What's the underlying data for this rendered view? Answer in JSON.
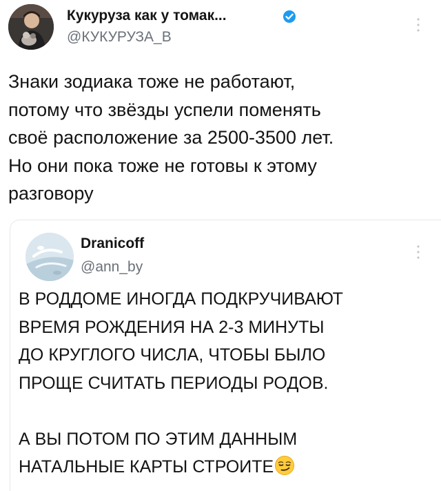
{
  "main_tweet": {
    "author_name": "Кукуруза как у томак...",
    "handle": "@КУКУРУЗА_В",
    "text": "Знаки зодиака тоже не работают,\nпотому что звёзды успели поменять\nсвоё расположение за 2500-3500 лет.\nНо они пока тоже не готовы к этому\nразговору",
    "verified_color": "#1d9bf0"
  },
  "quoted_tweet": {
    "author_name": "Dranicoff",
    "handle": "@ann_by",
    "text": "В РОДДОМЕ ИНОГДА ПОДКРУЧИВАЮТ\nВРЕМЯ РОЖДЕНИЯ НА 2-3 МИНУТЫ\nДО КРУГЛОГО ЧИСЛА, ЧТОБЫ БЫЛО\nПРОЩЕ СЧИТАТЬ ПЕРИОДЫ РОДОВ.\n\nА ВЫ ПОТОМ ПО ЭТИМ ДАННЫМ\nНАТАЛЬНЫЕ КАРТЫ СТРОИТЕ",
    "emoji": "smirking-face-icon"
  }
}
